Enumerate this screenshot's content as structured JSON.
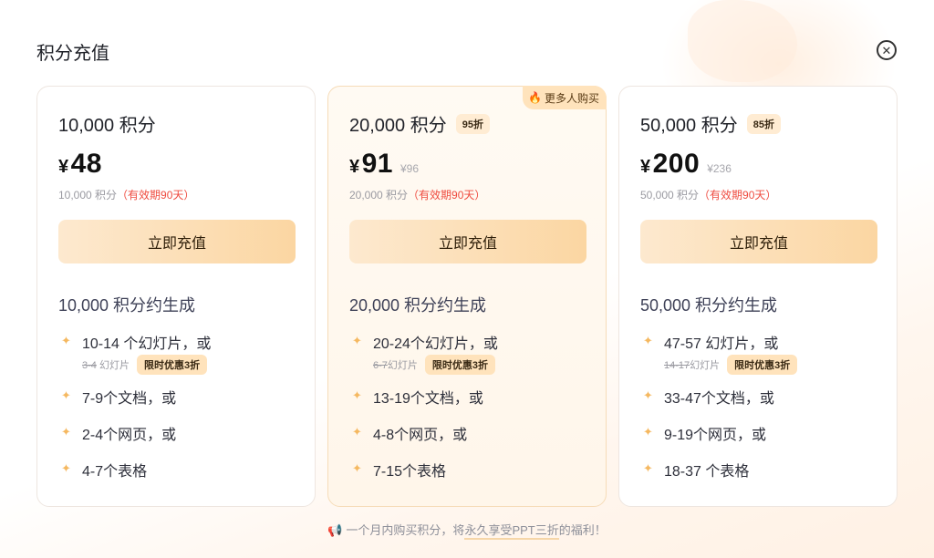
{
  "dialog": {
    "title": "积分充值"
  },
  "cards": [
    {
      "name": "10,000 积分",
      "discount": "",
      "ribbon": "",
      "currency": "¥",
      "price": "48",
      "original_price": "",
      "validity_points": "10,000 积分",
      "validity_note": "（有效期90天）",
      "button": "立即充值",
      "gen_title": "10,000 积分约生成",
      "items": [
        {
          "text": "10-14 个幻灯片，或",
          "strike": "3-4",
          "strike_suffix": " 幻灯片",
          "promo": "限时优惠3折"
        },
        {
          "text": "7-9个文档，或"
        },
        {
          "text": "2-4个网页，或"
        },
        {
          "text": "4-7个表格"
        }
      ]
    },
    {
      "name": "20,000 积分",
      "discount": "95折",
      "ribbon": "更多人购买",
      "currency": "¥",
      "price": "91",
      "original_price": "¥96",
      "validity_points": "20,000 积分",
      "validity_note": "（有效期90天）",
      "button": "立即充值",
      "gen_title": "20,000 积分约生成",
      "items": [
        {
          "text": "20-24个幻灯片，或",
          "strike": "6-7",
          "strike_suffix": "幻灯片",
          "promo": "限时优惠3折"
        },
        {
          "text": "13-19个文档，或"
        },
        {
          "text": "4-8个网页，或"
        },
        {
          "text": "7-15个表格"
        }
      ]
    },
    {
      "name": "50,000 积分",
      "discount": "85折",
      "ribbon": "",
      "currency": "¥",
      "price": "200",
      "original_price": "¥236",
      "validity_points": "50,000 积分",
      "validity_note": "（有效期90天）",
      "button": "立即充值",
      "gen_title": "50,000 积分约生成",
      "items": [
        {
          "text": "47-57 幻灯片，或",
          "strike": "14-17",
          "strike_suffix": "幻灯片",
          "promo": "限时优惠3折"
        },
        {
          "text": "33-47个文档，或"
        },
        {
          "text": "9-19个网页，或"
        },
        {
          "text": "18-37 个表格"
        }
      ]
    }
  ],
  "footer": {
    "prefix": "一个月内购买积分，将",
    "highlight": "永久享受PPT三折",
    "suffix": "的福利！"
  },
  "icons": {
    "close": "close-icon",
    "star": "sparkle-icon",
    "flame": "flame-icon",
    "megaphone": "megaphone-icon"
  },
  "colors": {
    "accent": "#fbd6a2",
    "promo_bg": "#ffe3bc",
    "validity_red": "#ef4b3f"
  }
}
